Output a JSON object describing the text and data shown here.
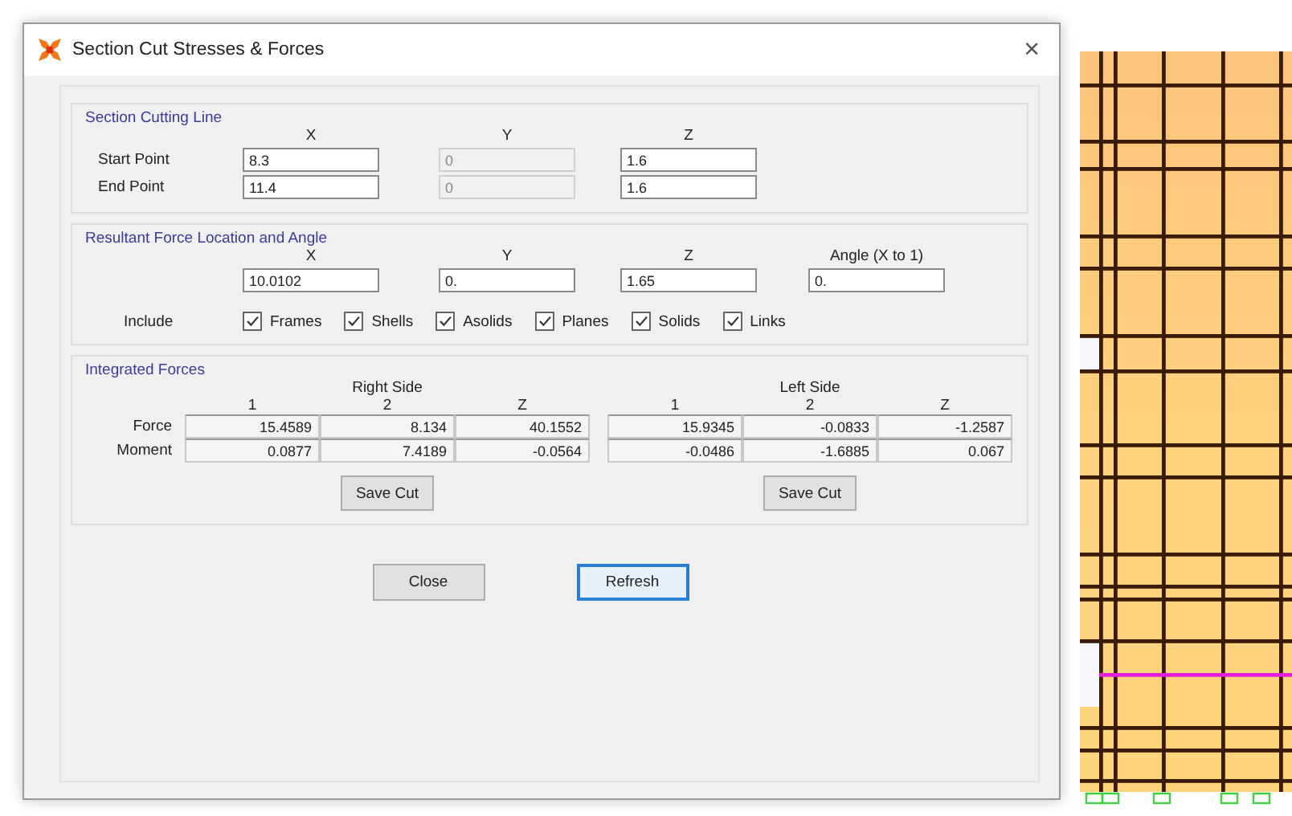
{
  "window": {
    "title": "Section Cut Stresses & Forces",
    "close": "×"
  },
  "section_cutting_line": {
    "title": "Section Cutting Line",
    "columns": [
      "X",
      "Y",
      "Z"
    ],
    "rows": [
      {
        "label": "Start Point",
        "fields": [
          {
            "value": "8.3",
            "disabled": false
          },
          {
            "value": "0",
            "disabled": true
          },
          {
            "value": "1.6",
            "disabled": false
          }
        ]
      },
      {
        "label": "End Point",
        "fields": [
          {
            "value": "11.4",
            "disabled": false
          },
          {
            "value": "0",
            "disabled": true
          },
          {
            "value": "1.6",
            "disabled": false
          }
        ]
      }
    ]
  },
  "resultant": {
    "title": "Resultant Force Location and Angle",
    "columns": [
      "X",
      "Y",
      "Z",
      "Angle (X to 1)"
    ],
    "fields": [
      {
        "value": "10.0102",
        "disabled": false
      },
      {
        "value": "0.",
        "disabled": false
      },
      {
        "value": "1.65",
        "disabled": false
      },
      {
        "value": "0.",
        "disabled": false
      }
    ],
    "includes_label": "Include",
    "includes": [
      {
        "label": "Frames",
        "checked": true
      },
      {
        "label": "Shells",
        "checked": true
      },
      {
        "label": "Asolids",
        "checked": true
      },
      {
        "label": "Planes",
        "checked": true
      },
      {
        "label": "Solids",
        "checked": true
      },
      {
        "label": "Links",
        "checked": true
      }
    ]
  },
  "integrated_forces": {
    "title": "Integrated Forces",
    "sides": [
      {
        "title": "Right Side",
        "columns": [
          "1",
          "2",
          "Z"
        ],
        "button": "Save Cut"
      },
      {
        "title": "Left Side",
        "columns": [
          "1",
          "2",
          "Z"
        ],
        "button": "Save Cut"
      }
    ],
    "rows": [
      {
        "label": "Force",
        "values": [
          [
            "15.4589",
            "8.134",
            "40.1552"
          ],
          [
            "15.9345",
            "-0.0833",
            "-1.2587"
          ]
        ]
      },
      {
        "label": "Moment",
        "values": [
          [
            "0.0877",
            "7.4189",
            "-0.0564"
          ],
          [
            "-0.0486",
            "-1.6885",
            "0.067"
          ]
        ]
      }
    ]
  },
  "buttons": [
    {
      "label": "Close",
      "focused": false
    },
    {
      "label": "Refresh",
      "focused": true
    }
  ]
}
